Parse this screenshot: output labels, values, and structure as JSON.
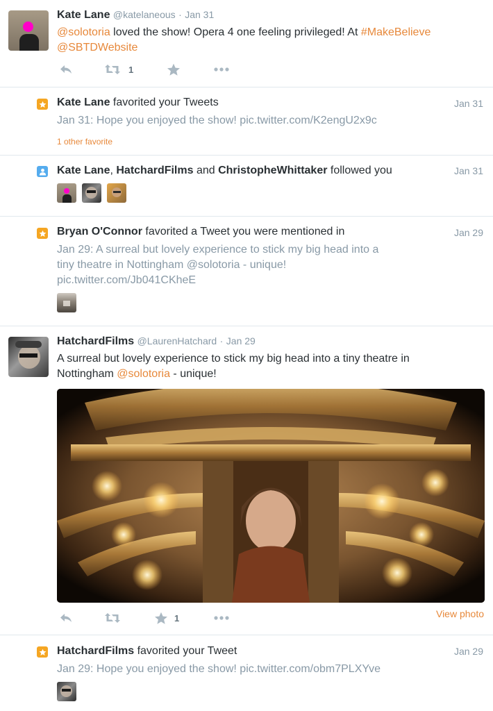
{
  "colors": {
    "accent": "#e7883a",
    "follow_badge": "#55acee",
    "favorite_badge": "#f5a623",
    "divider": "#e1e8ed",
    "muted": "#8899a6"
  },
  "tweet1": {
    "name": "Kate Lane",
    "handle": "@katelaneous",
    "sep": "·",
    "time": "Jan 31",
    "mention1": "@solotoria",
    "text1": " loved the show! Opera 4 one feeling privileged! At ",
    "hashtag": "#MakeBelieve",
    "mention2": "@SBTDWebsite",
    "retweet_count": "1"
  },
  "notif1": {
    "badge_icon": "star-icon",
    "actor": "Kate Lane",
    "action": " favorited your Tweets",
    "date": "Jan 31",
    "tweet_text": "Jan 31: Hope you enjoyed the show! pic.twitter.com/K2engU2x9c",
    "extra": "1 other favorite"
  },
  "notif2": {
    "badge_icon": "person-icon",
    "actor1": "Kate Lane",
    "comma": ", ",
    "actor2": "HatchardFilms",
    "and_text": " and ",
    "actor3": "ChristopheWhittaker",
    "action": " followed you",
    "date": "Jan 31"
  },
  "notif3": {
    "badge_icon": "star-icon",
    "actor": "Bryan O'Connor",
    "action": " favorited a Tweet you were mentioned in",
    "date": "Jan 29",
    "line1": "Jan 29: A surreal but lovely experience to stick my big head into a",
    "line2_pre": "tiny theatre in Nottingham ",
    "line2_mention": "@solotoria",
    "line2_post": " - unique!",
    "line3": "pic.twitter.com/Jb041CKheE"
  },
  "tweet2": {
    "name": "HatchardFilms",
    "handle": "@LaurenHatchard",
    "sep": "·",
    "time": "Jan 29",
    "line1": "A surreal but lovely experience to stick my big head into a tiny theatre in",
    "line2_pre": "Nottingham ",
    "line2_mention": "@solotoria",
    "line2_post": " - unique!",
    "favorite_count": "1",
    "view_photo": "View photo"
  },
  "notif4": {
    "badge_icon": "star-icon",
    "actor": "HatchardFilms",
    "action": " favorited your Tweet",
    "date": "Jan 29",
    "tweet_text": "Jan 29: Hope you enjoyed the show! pic.twitter.com/obm7PLXYve"
  }
}
